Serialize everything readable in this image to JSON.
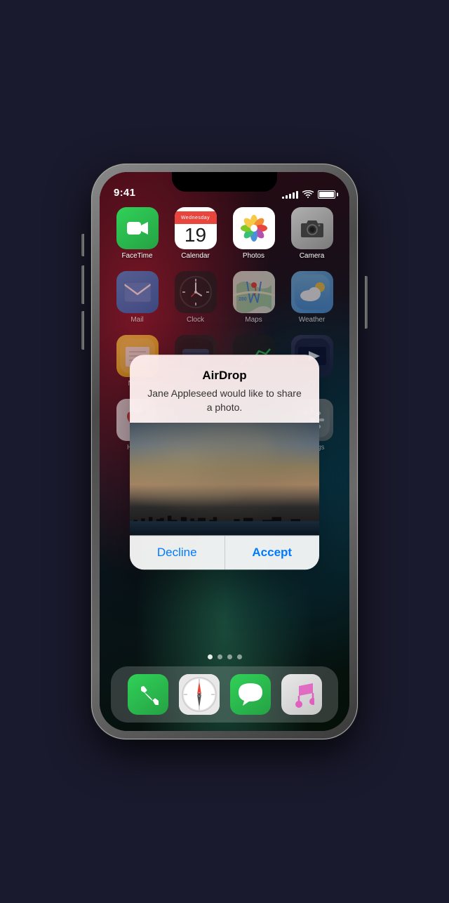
{
  "status": {
    "time": "9:41",
    "signal_bars": [
      4,
      6,
      9,
      11,
      13
    ],
    "battery_pct": 100
  },
  "apps": {
    "row1": [
      {
        "id": "facetime",
        "label": "FaceTime",
        "icon_type": "facetime"
      },
      {
        "id": "calendar",
        "label": "Calendar",
        "icon_type": "calendar",
        "cal_day": "Wednesday",
        "cal_date": "19"
      },
      {
        "id": "photos",
        "label": "Photos",
        "icon_type": "photos"
      },
      {
        "id": "camera",
        "label": "Camera",
        "icon_type": "camera"
      }
    ],
    "row2": [
      {
        "id": "mail",
        "label": "Mail",
        "icon_type": "mail"
      },
      {
        "id": "clock",
        "label": "Clock",
        "icon_type": "clock"
      },
      {
        "id": "maps",
        "label": "Maps",
        "icon_type": "maps"
      },
      {
        "id": "weather",
        "label": "Weather",
        "icon_type": "weather"
      }
    ],
    "row3": [
      {
        "id": "notes",
        "label": "Notes",
        "icon_type": "notes"
      },
      {
        "id": "wallet",
        "label": "Wallet",
        "icon_type": "wallet"
      },
      {
        "id": "stocks",
        "label": "Stocks",
        "icon_type": "stocks"
      },
      {
        "id": "tv",
        "label": "TV",
        "icon_type": "tv"
      }
    ],
    "row4": [
      {
        "id": "health",
        "label": "Health",
        "icon_type": "health"
      },
      {
        "id": "empty1",
        "label": "",
        "icon_type": "empty"
      },
      {
        "id": "empty2",
        "label": "",
        "icon_type": "empty"
      },
      {
        "id": "settings",
        "label": "Settings",
        "icon_type": "settings"
      }
    ]
  },
  "dock": [
    {
      "id": "phone",
      "label": "Phone",
      "icon_type": "phone"
    },
    {
      "id": "safari",
      "label": "Safari",
      "icon_type": "safari"
    },
    {
      "id": "messages",
      "label": "Messages",
      "icon_type": "messages"
    },
    {
      "id": "music",
      "label": "Music",
      "icon_type": "music"
    }
  ],
  "airdrop": {
    "title": "AirDrop",
    "message": "Jane Appleseed would like to share a photo.",
    "decline_label": "Decline",
    "accept_label": "Accept"
  },
  "page_dots": {
    "total": 4,
    "active_index": 0
  }
}
